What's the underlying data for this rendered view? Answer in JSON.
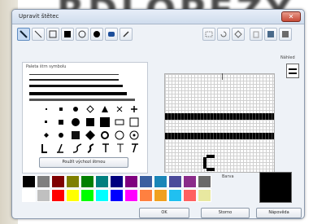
{
  "background": {
    "text": "RDLOPEZY"
  },
  "dialog": {
    "title": "Upravit štětec"
  },
  "symbols_panel": {
    "title": "Paleta štrn symbolu",
    "default_button": "Použít výchozí štrnou"
  },
  "preview": {
    "label": "Náhled"
  },
  "color_label": "Barva",
  "buttons": {
    "ok": "OK",
    "cancel": "Storno",
    "help": "Nápověda"
  },
  "palette": {
    "row1": [
      "#000000",
      "#7f7f7f",
      "#7f0000",
      "#7f7f00",
      "#007f00",
      "#007f7f",
      "#00007f",
      "#7f007f",
      "#3a5fa0",
      "#1a86b8",
      "#4b4b9b",
      "#8a2b8a",
      "#6a6a6a"
    ],
    "row2": [
      "#ffffff",
      "#c0c0c0",
      "#ff0000",
      "#ffff00",
      "#00ff00",
      "#00ffff",
      "#0000ff",
      "#ff00ff",
      "#ff8040",
      "#f0a020",
      "#20c0f0",
      "#ff6060",
      "#e8e8a0"
    ]
  },
  "selected_color": "#000000"
}
